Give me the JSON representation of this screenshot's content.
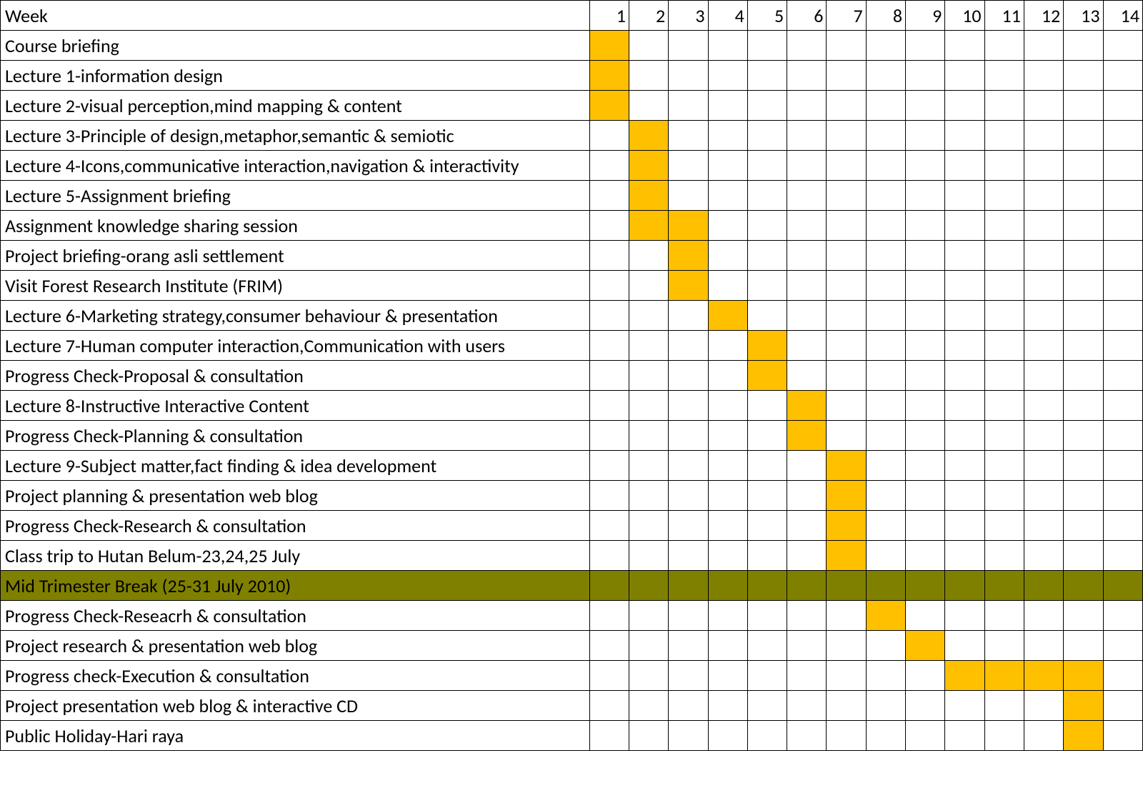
{
  "header": {
    "label": "Week",
    "weeks": [
      "1",
      "2",
      "3",
      "4",
      "5",
      "6",
      "7",
      "8",
      "9",
      "10",
      "11",
      "12",
      "13",
      "14"
    ]
  },
  "rows": [
    {
      "label": "Course briefing",
      "fill": [
        1
      ],
      "break": false
    },
    {
      "label": "Lecture 1-information design",
      "fill": [
        1
      ],
      "break": false
    },
    {
      "label": "Lecture 2-visual perception,mind mapping & content",
      "fill": [
        1
      ],
      "break": false
    },
    {
      "label": "Lecture 3-Principle of design,metaphor,semantic & semiotic",
      "fill": [
        2
      ],
      "break": false
    },
    {
      "label": "Lecture 4-Icons,communicative interaction,navigation & interactivity",
      "fill": [
        2
      ],
      "break": false
    },
    {
      "label": "Lecture 5-Assignment briefing",
      "fill": [
        2
      ],
      "break": false
    },
    {
      "label": "Assignment knowledge sharing session",
      "fill": [
        2,
        3
      ],
      "break": false
    },
    {
      "label": "Project briefing-orang asli settlement",
      "fill": [
        3
      ],
      "break": false
    },
    {
      "label": "Visit Forest Research Institute (FRIM)",
      "fill": [
        3
      ],
      "break": false
    },
    {
      "label": "Lecture 6-Marketing strategy,consumer behaviour & presentation",
      "fill": [
        4
      ],
      "break": false
    },
    {
      "label": "Lecture 7-Human computer interaction,Communication with users",
      "fill": [
        5
      ],
      "break": false
    },
    {
      "label": "Progress Check-Proposal & consultation",
      "fill": [
        5
      ],
      "break": false
    },
    {
      "label": "Lecture 8-Instructive Interactive Content",
      "fill": [
        6
      ],
      "break": false
    },
    {
      "label": "Progress Check-Planning & consultation",
      "fill": [
        6
      ],
      "break": false
    },
    {
      "label": "Lecture 9-Subject matter,fact finding & idea development",
      "fill": [
        7
      ],
      "break": false
    },
    {
      "label": "Project planning & presentation web blog",
      "fill": [
        7
      ],
      "break": false
    },
    {
      "label": "Progress Check-Research & consultation",
      "fill": [
        7
      ],
      "break": false
    },
    {
      "label": "Class trip to Hutan Belum-23,24,25 July",
      "fill": [
        7
      ],
      "break": false
    },
    {
      "label": "Mid Trimester Break (25-31 July 2010)",
      "fill": [],
      "break": true
    },
    {
      "label": "Progress Check-Reseacrh & consultation",
      "fill": [
        8
      ],
      "break": false
    },
    {
      "label": "Project research & presentation web blog",
      "fill": [
        9
      ],
      "break": false
    },
    {
      "label": "Progress check-Execution & consultation",
      "fill": [
        10,
        11,
        12,
        13
      ],
      "break": false
    },
    {
      "label": "Project presentation web blog & interactive CD",
      "fill": [
        13
      ],
      "break": false
    },
    {
      "label": "Public Holiday-Hari raya",
      "fill": [
        13
      ],
      "break": false
    }
  ],
  "chart_data": {
    "type": "table",
    "title": "Weekly schedule Gantt",
    "xlabel": "Week",
    "categories": [
      1,
      2,
      3,
      4,
      5,
      6,
      7,
      8,
      9,
      10,
      11,
      12,
      13,
      14
    ],
    "series": [
      {
        "name": "Course briefing",
        "weeks": [
          1
        ]
      },
      {
        "name": "Lecture 1-information design",
        "weeks": [
          1
        ]
      },
      {
        "name": "Lecture 2-visual perception,mind mapping & content",
        "weeks": [
          1
        ]
      },
      {
        "name": "Lecture 3-Principle of design,metaphor,semantic & semiotic",
        "weeks": [
          2
        ]
      },
      {
        "name": "Lecture 4-Icons,communicative interaction,navigation & interactivity",
        "weeks": [
          2
        ]
      },
      {
        "name": "Lecture 5-Assignment briefing",
        "weeks": [
          2
        ]
      },
      {
        "name": "Assignment knowledge sharing session",
        "weeks": [
          2,
          3
        ]
      },
      {
        "name": "Project briefing-orang asli settlement",
        "weeks": [
          3
        ]
      },
      {
        "name": "Visit Forest Research Institute (FRIM)",
        "weeks": [
          3
        ]
      },
      {
        "name": "Lecture 6-Marketing strategy,consumer behaviour & presentation",
        "weeks": [
          4
        ]
      },
      {
        "name": "Lecture 7-Human computer interaction,Communication with users",
        "weeks": [
          5
        ]
      },
      {
        "name": "Progress Check-Proposal & consultation",
        "weeks": [
          5
        ]
      },
      {
        "name": "Lecture 8-Instructive Interactive Content",
        "weeks": [
          6
        ]
      },
      {
        "name": "Progress Check-Planning & consultation",
        "weeks": [
          6
        ]
      },
      {
        "name": "Lecture 9-Subject matter,fact finding & idea development",
        "weeks": [
          7
        ]
      },
      {
        "name": "Project planning & presentation web blog",
        "weeks": [
          7
        ]
      },
      {
        "name": "Progress Check-Research & consultation",
        "weeks": [
          7
        ]
      },
      {
        "name": "Class trip to Hutan Belum-23,24,25 July",
        "weeks": [
          7
        ]
      },
      {
        "name": "Mid Trimester Break (25-31 July 2010)",
        "weeks": [
          1,
          2,
          3,
          4,
          5,
          6,
          7,
          8,
          9,
          10,
          11,
          12,
          13,
          14
        ],
        "type": "break"
      },
      {
        "name": "Progress Check-Reseacrh & consultation",
        "weeks": [
          8
        ]
      },
      {
        "name": "Project research & presentation web blog",
        "weeks": [
          9
        ]
      },
      {
        "name": "Progress check-Execution & consultation",
        "weeks": [
          10,
          11,
          12,
          13
        ]
      },
      {
        "name": "Project presentation web blog & interactive CD",
        "weeks": [
          13
        ]
      },
      {
        "name": "Public Holiday-Hari raya",
        "weeks": [
          13
        ]
      }
    ]
  }
}
